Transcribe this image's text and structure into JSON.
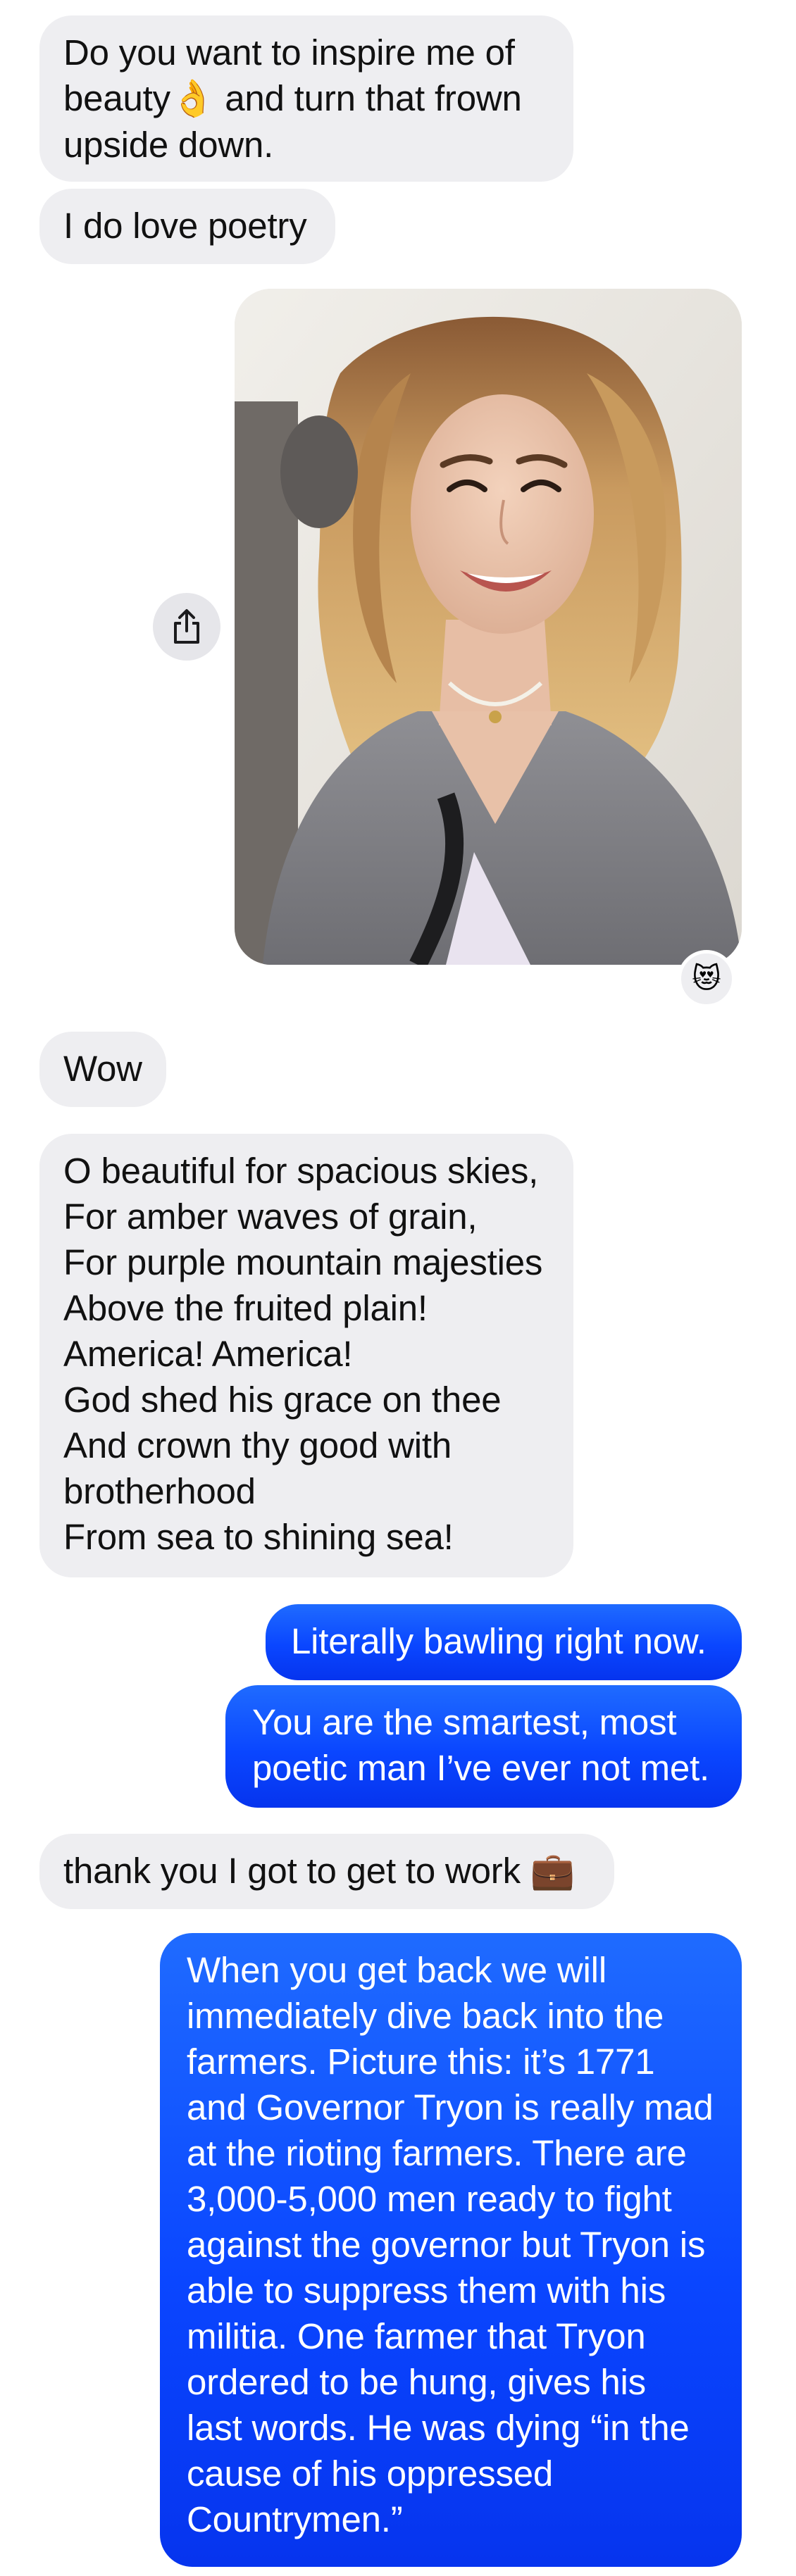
{
  "messages": {
    "m1": {
      "line1": "Do you want to inspire me of",
      "line2_a": "beauty",
      "line2_emoji": "👌",
      "line2_b": " and turn that frown",
      "line3": "upside down."
    },
    "m2": {
      "text": "I do love poetry"
    },
    "photo": {
      "share_icon": "share-icon",
      "reaction_emoji": "😻"
    },
    "m3": {
      "text": "Wow"
    },
    "poem": {
      "lines": [
        "O beautiful for spacious skies,",
        "For amber waves of grain,",
        "For purple mountain majesties",
        "Above the fruited plain!",
        "America! America!",
        "God shed his grace on thee",
        "And crown thy good with",
        "brotherhood",
        "From sea to shining sea!"
      ]
    },
    "r1": {
      "text": "Literally bawling right now."
    },
    "r2": {
      "line1": "You are the smartest, most",
      "line2": "poetic man I’ve ever not met."
    },
    "m4": {
      "text": "thank you I got to get to work ",
      "emoji": "💼"
    },
    "r3": {
      "lines": [
        "When you get back we will",
        "immediately dive back into the",
        "farmers. Picture this: it’s 1771",
        "and Governor Tryon is really mad",
        "at the rioting farmers. There are",
        "3,000-5,000 men ready to fight",
        "against the governor but Tryon is",
        "able to suppress them with his",
        "militia. One farmer that Tryon",
        "ordered to be hung, gives his",
        "last words. He was dying “in the",
        "cause of his oppressed",
        "Countrymen.”"
      ]
    }
  },
  "colors": {
    "incoming_bubble": "#eeeef1",
    "outgoing_bubble": "#0a46ff",
    "incoming_text": "#111111",
    "outgoing_text": "#ffffff"
  }
}
